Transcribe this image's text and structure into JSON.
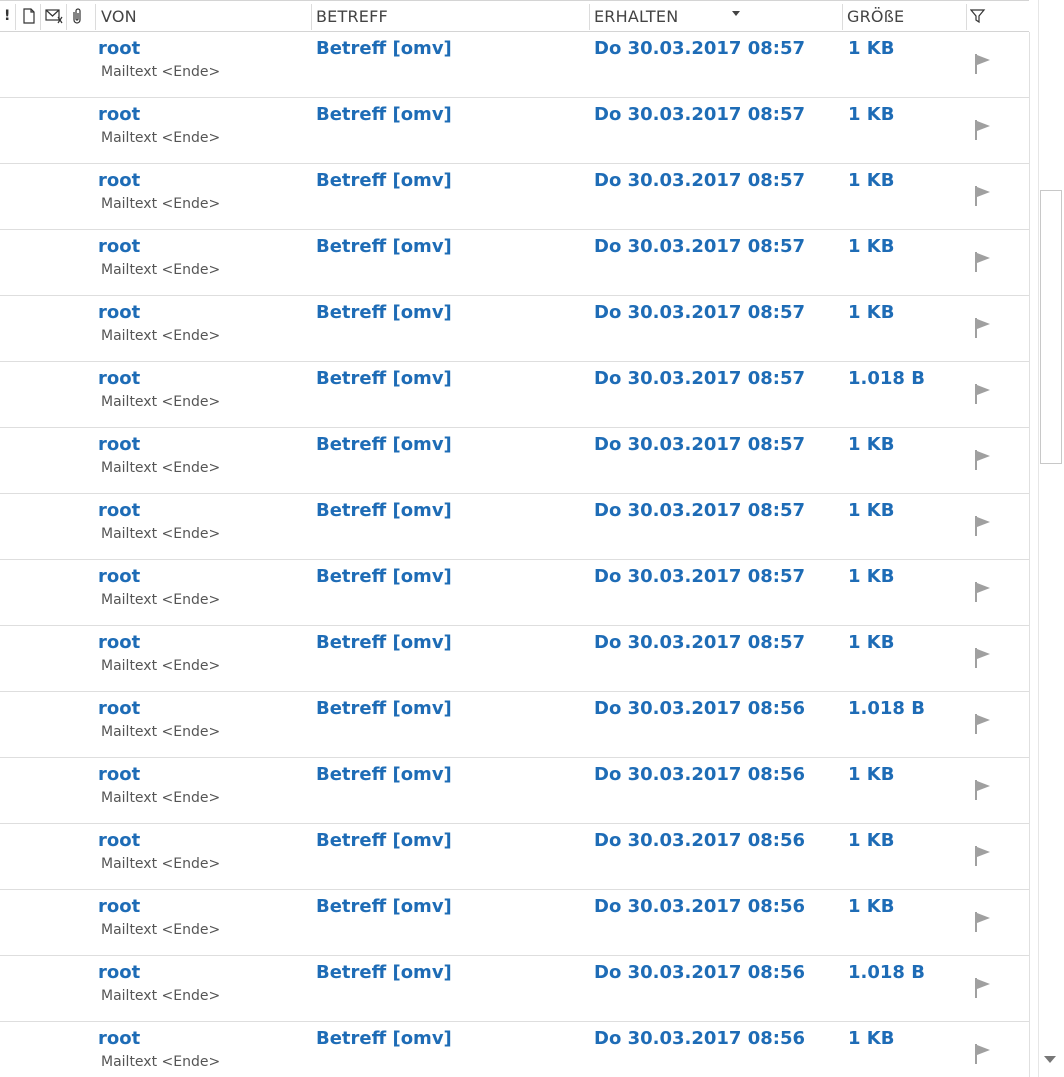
{
  "header": {
    "importance_icon": "!",
    "von": "VON",
    "betreff": "BETREFF",
    "erhalten": "ERHALTEN",
    "groesse": "GRÖßE"
  },
  "icons": {
    "importance": "exclamation-icon",
    "document": "document-icon",
    "reminder": "envelope-reminder-icon",
    "attachment": "paperclip-icon",
    "flag_filter": "flag-filter-icon",
    "flag": "flag-icon"
  },
  "colors": {
    "accent": "#1e6cb6",
    "flag": "#a0a0a0"
  },
  "messages": [
    {
      "from": "root",
      "preview": "Mailtext <Ende>",
      "subject": "Betreff [omv]",
      "received": "Do 30.03.2017 08:57",
      "size": "1 KB"
    },
    {
      "from": "root",
      "preview": "Mailtext <Ende>",
      "subject": "Betreff [omv]",
      "received": "Do 30.03.2017 08:57",
      "size": "1 KB"
    },
    {
      "from": "root",
      "preview": "Mailtext <Ende>",
      "subject": "Betreff [omv]",
      "received": "Do 30.03.2017 08:57",
      "size": "1 KB"
    },
    {
      "from": "root",
      "preview": "Mailtext <Ende>",
      "subject": "Betreff [omv]",
      "received": "Do 30.03.2017 08:57",
      "size": "1 KB"
    },
    {
      "from": "root",
      "preview": "Mailtext <Ende>",
      "subject": "Betreff [omv]",
      "received": "Do 30.03.2017 08:57",
      "size": "1 KB"
    },
    {
      "from": "root",
      "preview": "Mailtext <Ende>",
      "subject": "Betreff [omv]",
      "received": "Do 30.03.2017 08:57",
      "size": "1.018 B"
    },
    {
      "from": "root",
      "preview": "Mailtext <Ende>",
      "subject": "Betreff [omv]",
      "received": "Do 30.03.2017 08:57",
      "size": "1 KB"
    },
    {
      "from": "root",
      "preview": "Mailtext <Ende>",
      "subject": "Betreff [omv]",
      "received": "Do 30.03.2017 08:57",
      "size": "1 KB"
    },
    {
      "from": "root",
      "preview": "Mailtext <Ende>",
      "subject": "Betreff [omv]",
      "received": "Do 30.03.2017 08:57",
      "size": "1 KB"
    },
    {
      "from": "root",
      "preview": "Mailtext <Ende>",
      "subject": "Betreff [omv]",
      "received": "Do 30.03.2017 08:57",
      "size": "1 KB"
    },
    {
      "from": "root",
      "preview": "Mailtext <Ende>",
      "subject": "Betreff [omv]",
      "received": "Do 30.03.2017 08:56",
      "size": "1.018 B"
    },
    {
      "from": "root",
      "preview": "Mailtext <Ende>",
      "subject": "Betreff [omv]",
      "received": "Do 30.03.2017 08:56",
      "size": "1 KB"
    },
    {
      "from": "root",
      "preview": "Mailtext <Ende>",
      "subject": "Betreff [omv]",
      "received": "Do 30.03.2017 08:56",
      "size": "1 KB"
    },
    {
      "from": "root",
      "preview": "Mailtext <Ende>",
      "subject": "Betreff [omv]",
      "received": "Do 30.03.2017 08:56",
      "size": "1 KB"
    },
    {
      "from": "root",
      "preview": "Mailtext <Ende>",
      "subject": "Betreff [omv]",
      "received": "Do 30.03.2017 08:56",
      "size": "1.018 B"
    },
    {
      "from": "root",
      "preview": "Mailtext <Ende>",
      "subject": "Betreff [omv]",
      "received": "Do 30.03.2017 08:56",
      "size": "1 KB"
    }
  ]
}
